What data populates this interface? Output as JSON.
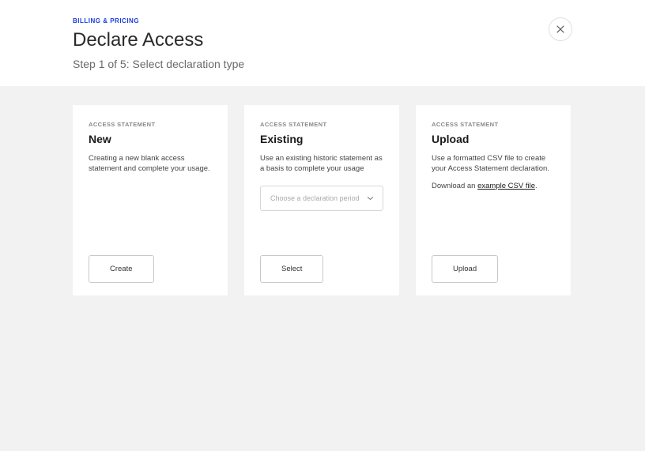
{
  "header": {
    "eyebrow": "BILLING & PRICING",
    "title": "Declare Access",
    "subtitle": "Step 1 of 5: Select declaration type"
  },
  "cards": {
    "new": {
      "eyebrow": "ACCESS STATEMENT",
      "title": "New",
      "desc": "Creating a new blank access statement and complete your usage.",
      "button": "Create"
    },
    "existing": {
      "eyebrow": "ACCESS STATEMENT",
      "title": "Existing",
      "desc": "Use an existing historic statement as a basis to complete your usage",
      "select_placeholder": "Choose a declaration period",
      "button": "Select"
    },
    "upload": {
      "eyebrow": "ACCESS STATEMENT",
      "title": "Upload",
      "desc": "Use a formatted CSV file to create your Access Statement declaration.",
      "download_prefix": "Download an ",
      "download_link": "example CSV file",
      "download_suffix": ".",
      "button": "Upload"
    }
  }
}
